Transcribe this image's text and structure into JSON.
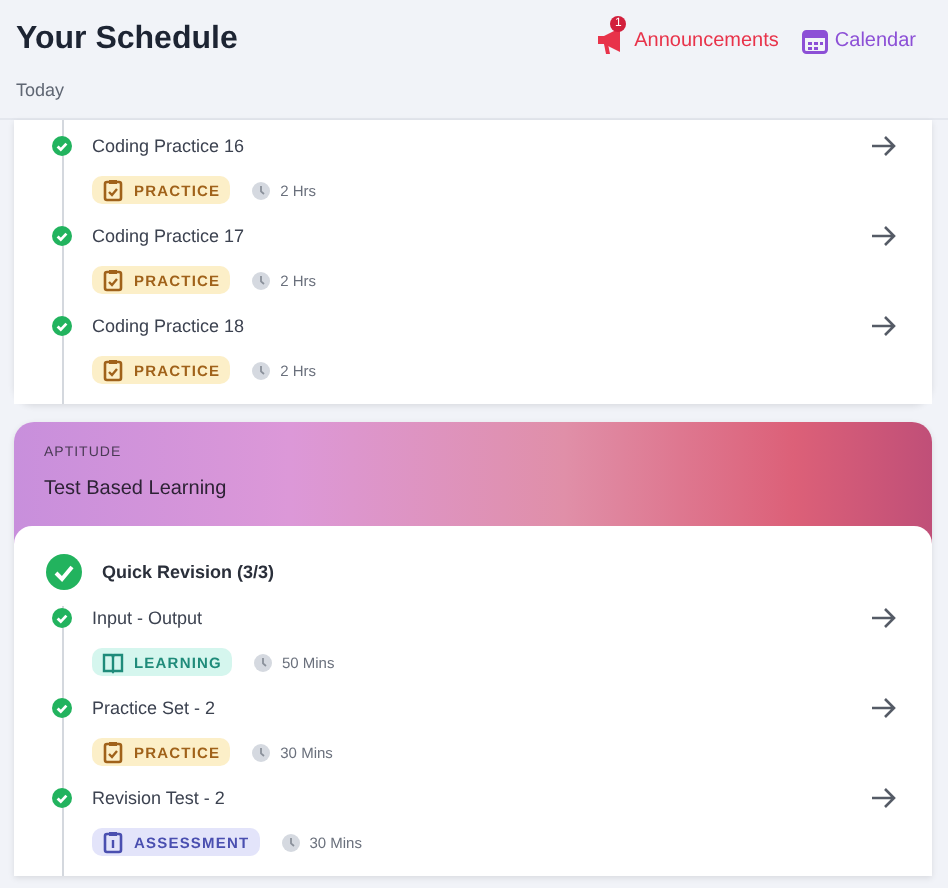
{
  "header": {
    "title": "Your Schedule",
    "subtitle": "Today",
    "announcements": {
      "label": "Announcements",
      "badge": "1"
    },
    "calendar": {
      "label": "Calendar"
    }
  },
  "sections": [
    {
      "items": [
        {
          "title": "Coding Practice 16",
          "tag": {
            "kind": "practice",
            "label": "PRACTICE"
          },
          "duration": "2 Hrs",
          "completed": true
        },
        {
          "title": "Coding Practice 17",
          "tag": {
            "kind": "practice",
            "label": "PRACTICE"
          },
          "duration": "2 Hrs",
          "completed": true
        },
        {
          "title": "Coding Practice 18",
          "tag": {
            "kind": "practice",
            "label": "PRACTICE"
          },
          "duration": "2 Hrs",
          "completed": true
        }
      ]
    },
    {
      "category": "APTITUDE",
      "name": "Test Based Learning",
      "group": {
        "title": "Quick Revision (3/3)",
        "completed": true
      },
      "items": [
        {
          "title": "Input - Output",
          "tag": {
            "kind": "learning",
            "label": "LEARNING"
          },
          "duration": "50 Mins",
          "completed": true
        },
        {
          "title": "Practice Set - 2",
          "tag": {
            "kind": "practice",
            "label": "PRACTICE"
          },
          "duration": "30 Mins",
          "completed": true
        },
        {
          "title": "Revision Test - 2",
          "tag": {
            "kind": "assessment",
            "label": "ASSESSMENT"
          },
          "duration": "30 Mins",
          "completed": true
        }
      ]
    }
  ]
}
